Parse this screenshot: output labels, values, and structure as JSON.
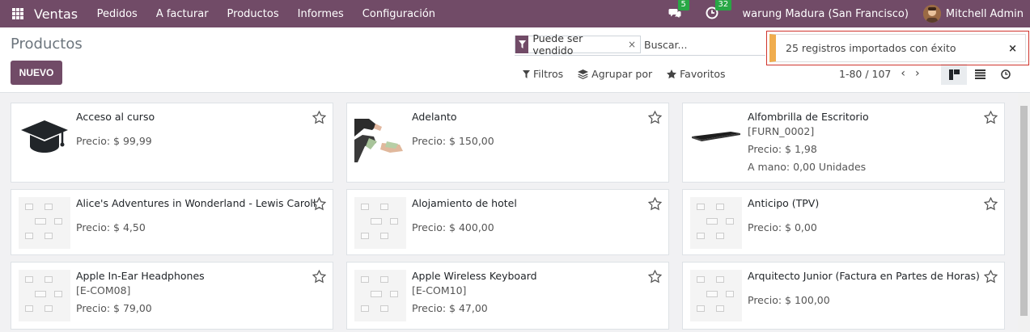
{
  "navbar": {
    "app_name": "Ventas",
    "menu": [
      "Pedidos",
      "A facturar",
      "Productos",
      "Informes",
      "Configuración"
    ],
    "messages_count": "5",
    "activities_count": "32",
    "company": "warung Madura (San Francisco)",
    "user": "Mitchell Admin"
  },
  "control": {
    "title": "Productos",
    "new_button": "NUEVO",
    "facet_label": "Puede ser vendido",
    "facet_remove": "×",
    "search_placeholder": "Buscar...",
    "filters": "Filtros",
    "group_by": "Agrupar por",
    "favorites": "Favoritos",
    "pager": "1-80 / 107",
    "pager_prev": "‹",
    "pager_next": "›"
  },
  "toast": {
    "message": "25 registros importados con éxito",
    "close": "×"
  },
  "cards": [
    {
      "title": "Acceso al curso",
      "lines": [
        "Precio: $ 99,99"
      ],
      "image": "graduation-cap-icon"
    },
    {
      "title": "Adelanto",
      "lines": [
        "Precio: $ 150,00"
      ],
      "image": "money-hands-photo"
    },
    {
      "title": "Alfombrilla de Escritorio",
      "lines": [
        "[FURN_0002]",
        "Precio: $ 1,98",
        "A mano: 0,00 Unidades"
      ],
      "image": "desk-pad-photo"
    },
    {
      "title": "Alice's Adventures in Wonderland - Lewis Caroll",
      "lines": [
        "Precio: $ 4,50"
      ],
      "image": "placeholder-icon"
    },
    {
      "title": "Alojamiento de hotel",
      "lines": [
        "Precio: $ 400,00"
      ],
      "image": "placeholder-icon"
    },
    {
      "title": "Anticipo (TPV)",
      "lines": [
        "Precio: $ 0,00"
      ],
      "image": "placeholder-icon"
    },
    {
      "title": "Apple In-Ear Headphones",
      "lines": [
        "[E-COM08]",
        "Precio: $ 79,00"
      ],
      "image": "placeholder-icon"
    },
    {
      "title": "Apple Wireless Keyboard",
      "lines": [
        "[E-COM10]",
        "Precio: $ 47,00"
      ],
      "image": "placeholder-icon"
    },
    {
      "title": "Arquitecto Junior (Factura en Partes de Horas)",
      "lines": [
        "Precio: $ 100,00"
      ],
      "image": "placeholder-icon"
    }
  ],
  "colors": {
    "brand": "#714b67",
    "badge": "#28a745",
    "toast_accent": "#f0ad4e",
    "toast_border": "#d0342c"
  }
}
